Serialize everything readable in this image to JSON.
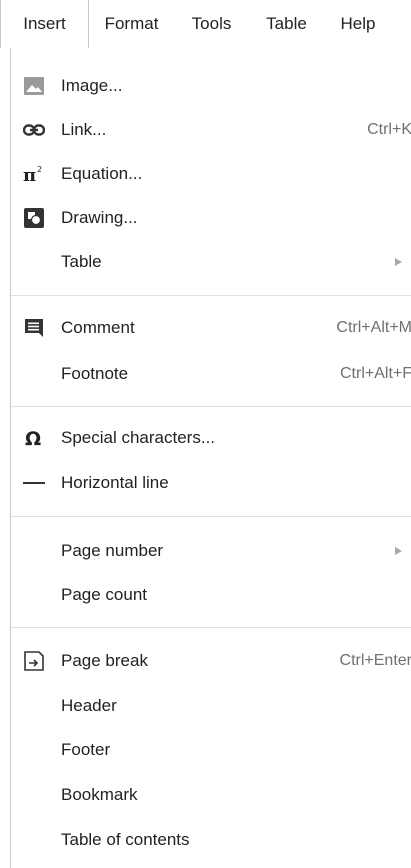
{
  "menubar": {
    "items": [
      {
        "label": "Insert"
      },
      {
        "label": "Format"
      },
      {
        "label": "Tools"
      },
      {
        "label": "Table"
      },
      {
        "label": "Help"
      }
    ]
  },
  "menu": {
    "image": {
      "label": "Image...",
      "icon": "image-icon"
    },
    "link": {
      "label": "Link...",
      "shortcut": "Ctrl+K",
      "icon": "link-icon"
    },
    "equation": {
      "label": "Equation...",
      "icon": "pi-icon"
    },
    "drawing": {
      "label": "Drawing...",
      "icon": "drawing-icon"
    },
    "table": {
      "label": "Table",
      "submenu": true
    },
    "comment": {
      "label": "Comment",
      "shortcut": "Ctrl+Alt+M",
      "icon": "comment-icon"
    },
    "footnote": {
      "label": "Footnote",
      "shortcut": "Ctrl+Alt+F"
    },
    "special_characters": {
      "label": "Special characters...",
      "icon": "omega-icon"
    },
    "horizontal_line": {
      "label": "Horizontal line",
      "icon": "horizontal-line-icon"
    },
    "page_number": {
      "label": "Page number",
      "submenu": true
    },
    "page_count": {
      "label": "Page count"
    },
    "page_break": {
      "label": "Page break",
      "shortcut": "Ctrl+Enter",
      "icon": "page-break-icon"
    },
    "header": {
      "label": "Header"
    },
    "footer": {
      "label": "Footer"
    },
    "bookmark": {
      "label": "Bookmark"
    },
    "table_of_contents": {
      "label": "Table of contents"
    }
  },
  "colors": {
    "icon": "#555555",
    "shortcut": "#707070",
    "border": "#c8c8c8"
  }
}
